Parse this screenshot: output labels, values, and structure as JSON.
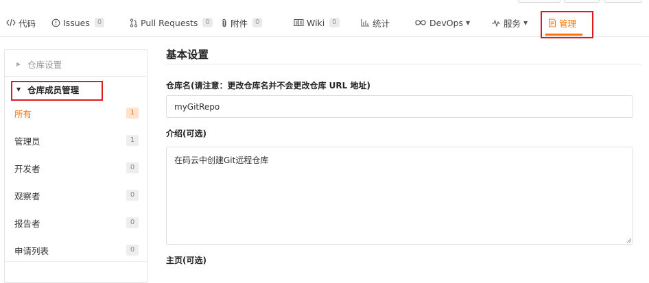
{
  "tabs": [
    {
      "id": "code",
      "icon": "code-icon",
      "label": "代码",
      "count": null
    },
    {
      "id": "issues",
      "icon": "issues-icon",
      "label": "Issues",
      "count": "0"
    },
    {
      "id": "pulls",
      "icon": "pull-request-icon",
      "label": "Pull Requests",
      "count": "0"
    },
    {
      "id": "attachments",
      "icon": "paperclip-icon",
      "label": "附件",
      "count": "0"
    },
    {
      "id": "wiki",
      "icon": "wiki-icon",
      "label": "Wiki",
      "count": "0"
    },
    {
      "id": "stats",
      "icon": "chart-icon",
      "label": "统计",
      "count": null
    },
    {
      "id": "devops",
      "icon": "infinity-icon",
      "label": "DevOps",
      "count": null,
      "dropdown": true
    },
    {
      "id": "services",
      "icon": "pulse-icon",
      "label": "服务",
      "count": null,
      "dropdown": true
    },
    {
      "id": "manage",
      "icon": "manage-icon",
      "label": "管理",
      "count": null,
      "active": true
    }
  ],
  "sidebar": {
    "repo_settings_label": "仓库设置",
    "members_group_label": "仓库成员管理",
    "items": [
      {
        "label": "所有",
        "count": "1",
        "active": true
      },
      {
        "label": "管理员",
        "count": "1"
      },
      {
        "label": "开发者",
        "count": "0"
      },
      {
        "label": "观察者",
        "count": "0"
      },
      {
        "label": "报告者",
        "count": "0"
      },
      {
        "label": "申请列表",
        "count": "0"
      }
    ]
  },
  "form": {
    "title": "基本设置",
    "repo_name_label": "仓库名(请注意：更改仓库名并不会更改仓库 URL 地址)",
    "repo_name_value": "myGitRepo",
    "intro_label": "介绍(可选)",
    "intro_value": "在码云中创建Git远程仓库",
    "homepage_label": "主页(可选)"
  },
  "colors": {
    "accent": "#fe7300",
    "highlight_box": "#e0191f"
  }
}
